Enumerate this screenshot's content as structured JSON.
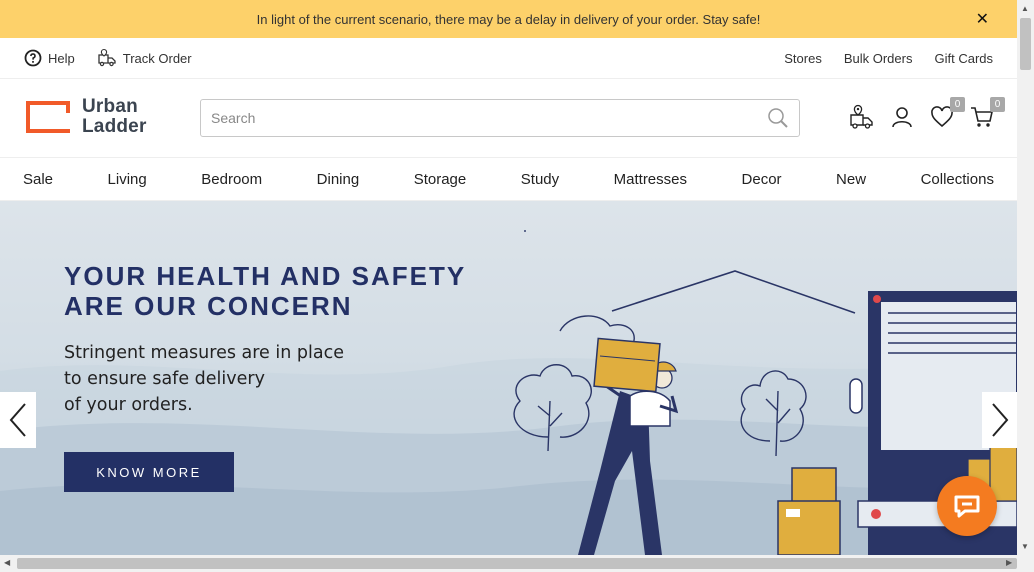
{
  "announcement": {
    "text": "In light of the current scenario, there may be a delay in delivery of your order. Stay safe!",
    "close_label": "✕"
  },
  "utility": {
    "help": "Help",
    "track_order": "Track Order",
    "stores": "Stores",
    "bulk_orders": "Bulk Orders",
    "gift_cards": "Gift Cards"
  },
  "logo": {
    "line1": "Urban",
    "line2": "Ladder",
    "accent_color": "#f15a29"
  },
  "search": {
    "placeholder": "Search",
    "value": ""
  },
  "header_icons": {
    "wishlist_count": "0",
    "cart_count": "0",
    "icons": [
      "store-locator-icon",
      "user-icon",
      "heart-icon",
      "cart-icon"
    ]
  },
  "nav": {
    "items": [
      "Sale",
      "Living",
      "Bedroom",
      "Dining",
      "Storage",
      "Study",
      "Mattresses",
      "Decor",
      "New",
      "Collections"
    ]
  },
  "hero": {
    "headline_line1": "YOUR HEALTH AND SAFETY",
    "headline_line2": "ARE OUR CONCERN",
    "sub_line1": "Stringent measures are in place",
    "sub_line2": "to ensure safe delivery",
    "sub_line3": "of your orders.",
    "cta": "KNOW MORE",
    "navy": "#233065",
    "box_color": "#e0ae3e"
  }
}
